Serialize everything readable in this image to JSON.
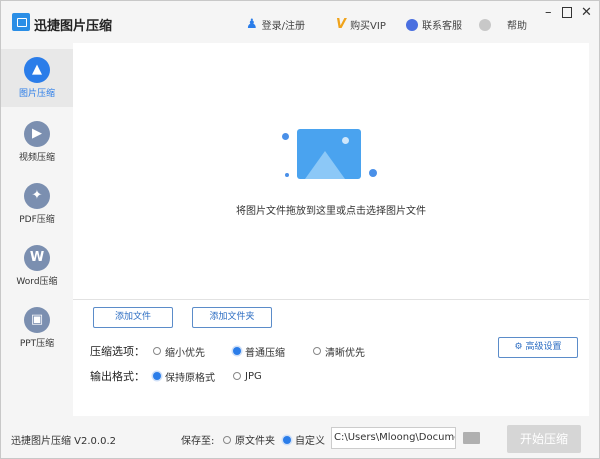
{
  "app": {
    "title": "迅捷图片压缩",
    "version_text": "迅捷图片压缩 V2.0.0.2"
  },
  "header": {
    "login": "登录/注册",
    "vip": "购买VIP",
    "support": "联系客服",
    "help": "帮助"
  },
  "sidebar": {
    "items": [
      {
        "label": "图片压缩",
        "icon": "image"
      },
      {
        "label": "视频压缩",
        "icon": "play"
      },
      {
        "label": "PDF压缩",
        "icon": "pdf"
      },
      {
        "label": "Word压缩",
        "icon": "W"
      },
      {
        "label": "PPT压缩",
        "icon": "ppt"
      }
    ]
  },
  "main": {
    "drop_hint": "将图片文件拖放到这里或点击选择图片文件",
    "add_file": "添加文件",
    "add_folder": "添加文件夹",
    "compress_label": "压缩选项：",
    "compress_options": [
      "缩小优先",
      "普通压缩",
      "清晰优先"
    ],
    "compress_selected": "普通压缩",
    "format_label": "输出格式：",
    "format_options": [
      "保持原格式",
      "JPG"
    ],
    "format_selected": "保持原格式",
    "advanced": "高级设置"
  },
  "footer": {
    "save_to": "保存至:",
    "save_options": [
      "原文件夹",
      "自定义"
    ],
    "save_selected": "自定义",
    "path": "C:\\Users\\Mloong\\Documents",
    "start": "开始压缩"
  },
  "colors": {
    "accent": "#2b7de9"
  }
}
